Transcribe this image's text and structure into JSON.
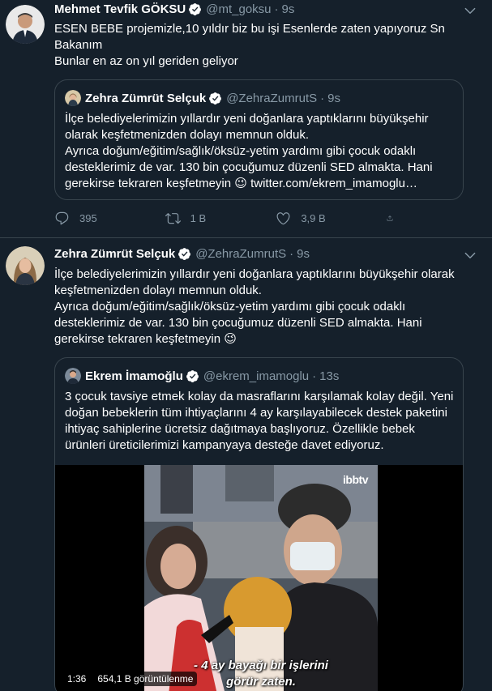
{
  "tweet1": {
    "author_name": "Mehmet Tevfik GÖKSU",
    "author_handle": "@mt_goksu",
    "separator": "·",
    "time": "9s",
    "text": "ESEN BEBE projemizle,10 yıldır biz bu işi Esenlerde zaten yapıyoruz Sn Bakanım\nBunlar en az on yıl geriden geliyor",
    "quote": {
      "author_name": "Zehra Zümrüt Selçuk",
      "author_handle": "@ZehraZumrutS",
      "separator": "·",
      "time": "9s",
      "text_main": "İlçe belediyelerimizin yıllardır yeni doğanlara yaptıklarını büyükşehir olarak keşfetmenizden dolayı memnun olduk.\nAyrıca doğum/eğitim/sağlık/öksüz-yetim yardımı gibi çocuk odaklı desteklerimiz de var. 130 bin çocuğumuz düzenli SED almakta. Hani gerekirse tekraren keşfetmeyin ",
      "emoji": "😉",
      "link": " twitter.com/ekrem_imamoglu…"
    },
    "actions": {
      "reply_count": "395",
      "retweet_count": "1 B",
      "like_count": "3,9 B"
    }
  },
  "tweet2": {
    "author_name": "Zehra Zümrüt Selçuk",
    "author_handle": "@ZehraZumrutS",
    "separator": "·",
    "time": "9s",
    "text_main": "İlçe belediyelerimizin yıllardır yeni doğanlara yaptıklarını büyükşehir olarak keşfetmenizden dolayı memnun olduk.\nAyrıca doğum/eğitim/sağlık/öksüz-yetim yardımı gibi çocuk odaklı desteklerimiz de var. 130 bin çocuğumuz düzenli SED almakta. Hani gerekirse tekraren keşfetmeyin ",
    "emoji": "😉",
    "quote": {
      "author_name": "Ekrem İmamoğlu",
      "author_handle": "@ekrem_imamoglu",
      "separator": "·",
      "time": "13s",
      "text": "3 çocuk tavsiye etmek kolay da masraflarını karşılamak kolay değil. Yeni doğan bebeklerin tüm ihtiyaçlarını 4 ay karşılayabilecek destek paketini ihtiyaç sahiplerine ücretsiz dağıtmaya başlıyoruz. Özellikle bebek ürünleri üreticilerimizi kampanyaya desteğe davet ediyoruz.",
      "video": {
        "brand": "ibbtv",
        "subtitle_line1": "- 4 ay bayağı bir işlerini",
        "subtitle_line2": "görür zaten.",
        "duration": "1:36",
        "views": "654,1 B görüntülenme"
      }
    }
  },
  "colors": {
    "background": "#15202b",
    "border": "#38444d",
    "secondary_text": "#8899a6",
    "verified": "#1da1f2"
  },
  "icons": [
    "verified-badge-icon",
    "chevron-down-icon",
    "reply-icon",
    "retweet-icon",
    "like-icon",
    "share-icon"
  ]
}
